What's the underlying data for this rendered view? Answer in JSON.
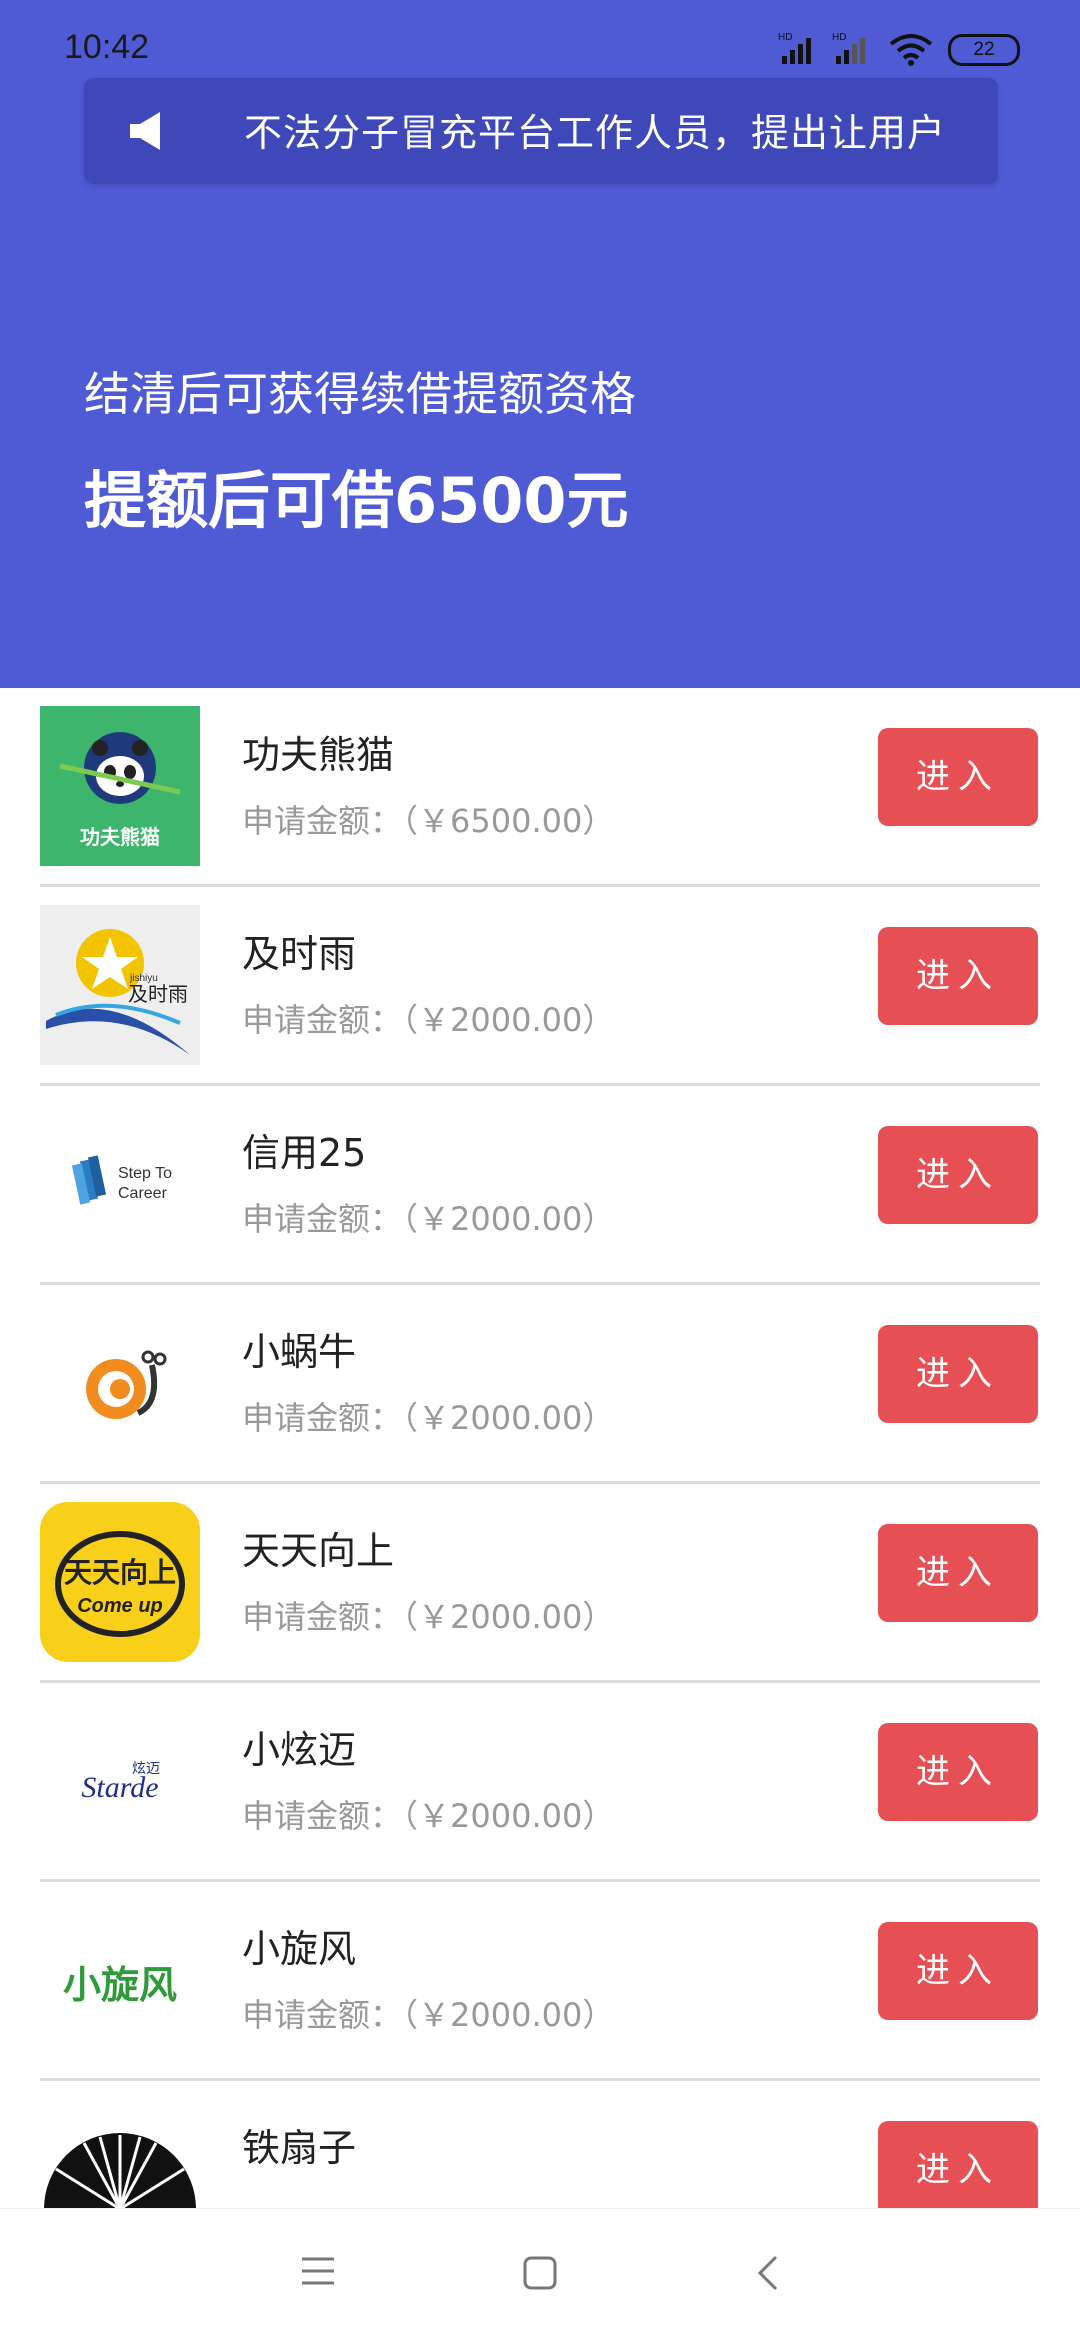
{
  "status": {
    "time": "10:42",
    "battery": "22"
  },
  "notice": {
    "text": "不法分子冒充平台工作人员，提出让用户"
  },
  "hero": {
    "subtitle": "结清后可获得续借提额资格",
    "title": "提额后可借6500元"
  },
  "colors": {
    "hero_bg": "#4F5BD5",
    "notice_bg": "#3E48B8",
    "button": "#E65054"
  },
  "products": [
    {
      "name": "功夫熊猫",
      "amount": "申请金额：（￥6500.00）",
      "button": "进入",
      "logo": "kungfu-panda-logo"
    },
    {
      "name": "及时雨",
      "amount": "申请金额：（￥2000.00）",
      "button": "进入",
      "logo": "jishiyu-logo"
    },
    {
      "name": "信用25",
      "amount": "申请金额：（￥2000.00）",
      "button": "进入",
      "logo": "step-to-career-logo"
    },
    {
      "name": "小蜗牛",
      "amount": "申请金额：（￥2000.00）",
      "button": "进入",
      "logo": "snail-logo"
    },
    {
      "name": "天天向上",
      "amount": "申请金额：（￥2000.00）",
      "button": "进入",
      "logo": "come-up-logo"
    },
    {
      "name": "小炫迈",
      "amount": "申请金额：（￥2000.00）",
      "button": "进入",
      "logo": "starde-logo"
    },
    {
      "name": "小旋风",
      "amount": "申请金额：（￥2000.00）",
      "button": "进入",
      "logo": "xiaoxuanfeng-logo"
    },
    {
      "name": "铁扇子",
      "amount": "",
      "button": "进入",
      "logo": "fan-logo"
    }
  ],
  "logo_text": {
    "panda": "功夫熊猫",
    "jishiyu_en": "jishiyu",
    "jishiyu_cn": "及时雨",
    "step_l1": "Step To",
    "step_l2": "Career",
    "comeup_cn": "天天向上",
    "comeup_en": "Come up",
    "starde_cn": "炫迈",
    "starde_en": "Starde",
    "xxf": "小旋风"
  },
  "nav": {
    "menu_icon": "menu-icon",
    "home_icon": "home-square-icon",
    "back_icon": "back-chevron-icon"
  }
}
